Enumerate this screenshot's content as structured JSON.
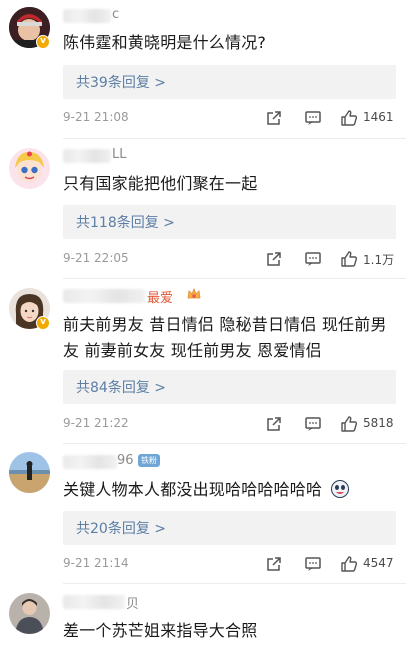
{
  "comments": [
    {
      "name_suffix": "c",
      "text": "陈伟霆和黄晓明是什么情况?",
      "replies": "共39条回复 >",
      "time": "9-21 21:08",
      "likes": "1461"
    },
    {
      "name_suffix": "LL",
      "text": "只有国家能把他们聚在一起",
      "replies": "共118条回复 >",
      "time": "9-21 22:05",
      "likes": "1.1万"
    },
    {
      "name_suffix": "最爱",
      "text": "前夫前男友 昔日情侣 隐秘昔日情侣 现任前男友 前妻前女友 现任前男友 恩爱情侣",
      "replies": "共84条回复 >",
      "time": "9-21 21:22",
      "likes": "5818"
    },
    {
      "name_suffix": "96",
      "badge": "铁粉",
      "text": "关键人物本人都没出现哈哈哈哈哈哈",
      "replies": "共20条回复 >",
      "time": "9-21 21:14",
      "likes": "4547"
    },
    {
      "name_suffix": "贝",
      "text": "差一个苏芒姐来指导大合照"
    }
  ],
  "icons": {
    "share": "share-icon",
    "comment": "comment-icon",
    "like": "thumbs-up-icon",
    "verified": "verified-badge-icon"
  },
  "colors": {
    "reply_link": "#5d7ea5",
    "reply_bg": "#f2f2f2",
    "verified": "#f2a900"
  }
}
